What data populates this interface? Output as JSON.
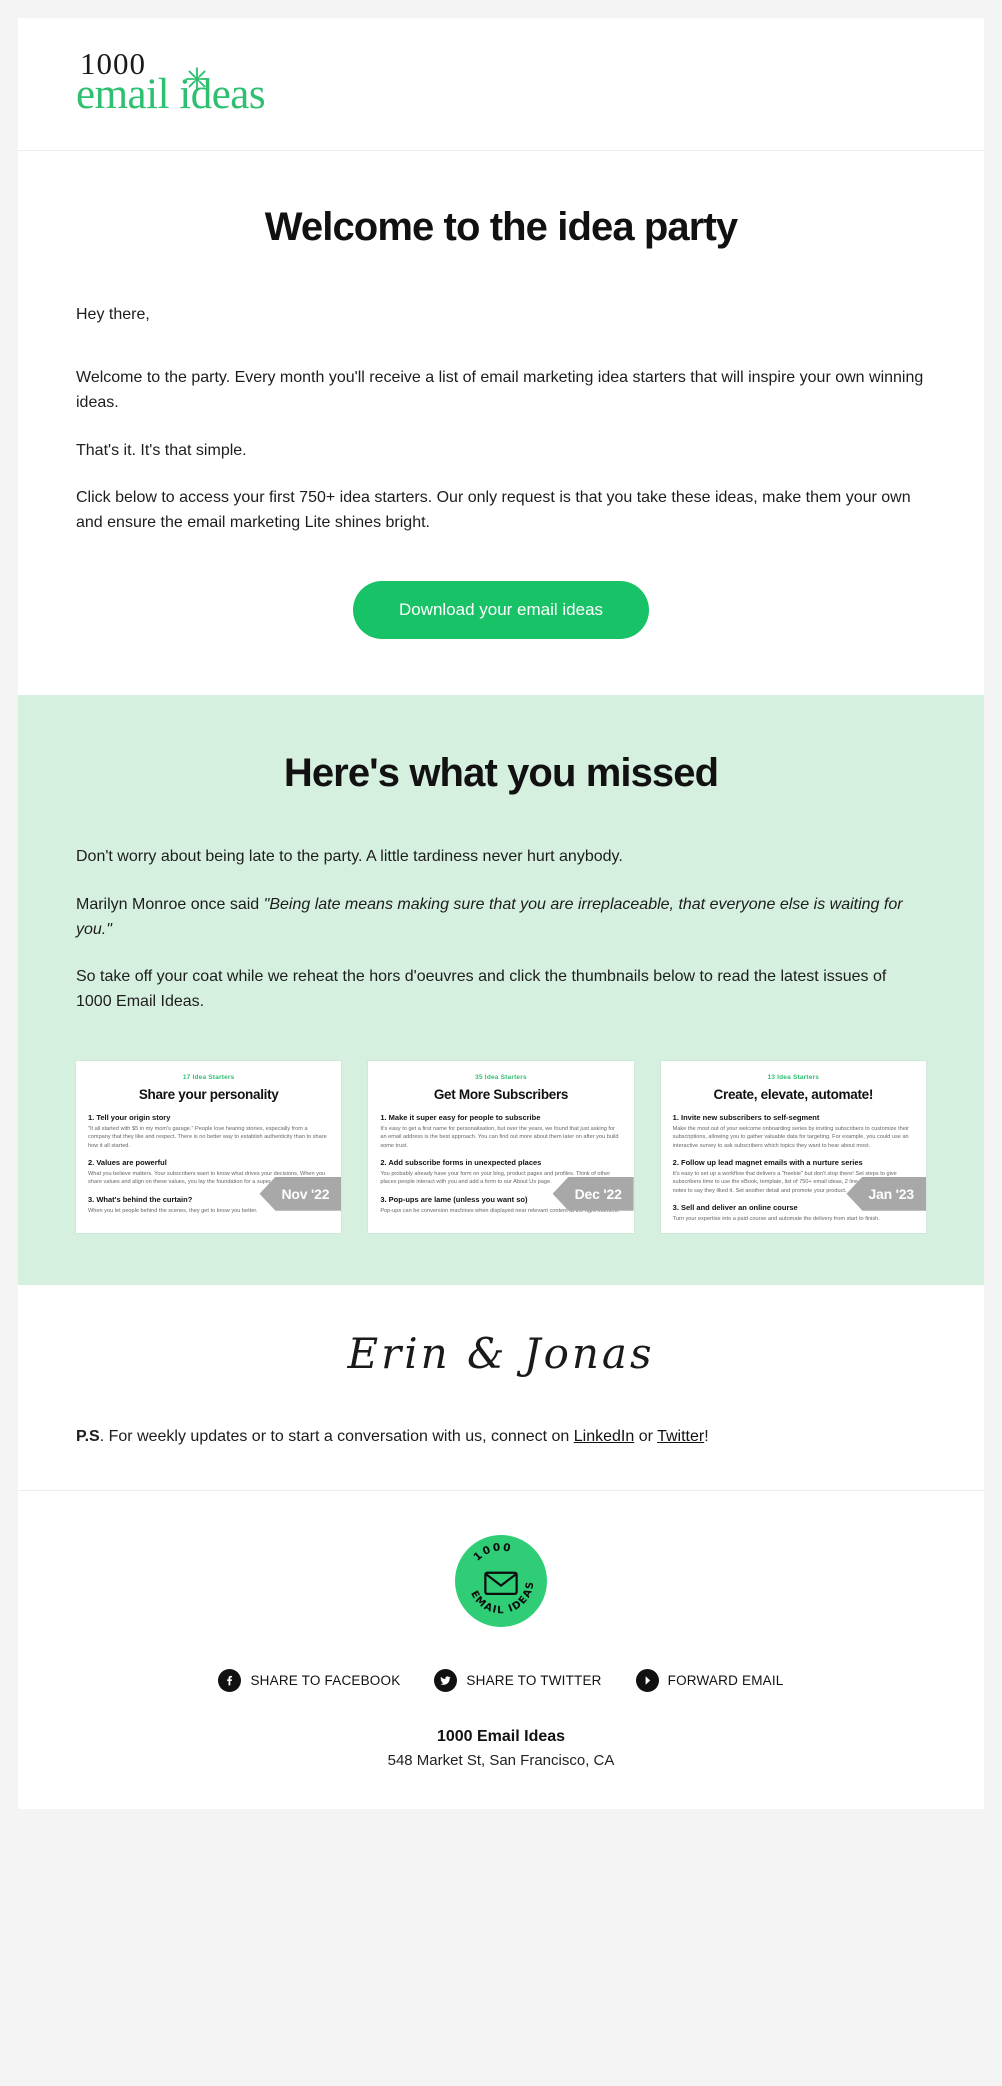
{
  "brand": {
    "logo_top": "1000",
    "logo_bottom": "email ideas",
    "spark_icon": "sparkle-icon",
    "accent_green": "#2fbf71",
    "button_green": "#18c266",
    "mint_bg": "#d6f0e0"
  },
  "intro": {
    "title": "Welcome to the idea party",
    "greeting": "Hey there,",
    "p1": "Welcome to the party. Every month you'll receive a list of email marketing idea starters that will inspire your own winning ideas.",
    "p2": "That's it. It's that simple.",
    "p3": "Click below to access your first 750+ idea starters. Our only request is that you take these ideas, make them your own and ensure the email marketing Lite shines bright.",
    "cta_label": "Download your email ideas"
  },
  "missed": {
    "title": "Here's what you missed",
    "p1": "Don't worry about being late to the party. A little tardiness never hurt anybody.",
    "quote_lead": "Marilyn Monroe once said ",
    "quote": "\"Being late means making sure that you are irreplaceable, that everyone else is waiting for you.\"",
    "p3": "So take off your coat while we reheat the hors d'oeuvres and click the thumbnails below to read the latest issues of 1000 Email Ideas.",
    "cards": [
      {
        "eyebrow": "17 Idea Starters",
        "title": "Share your personality",
        "badge": "Nov '22",
        "items": [
          {
            "heading": "1. Tell your origin story",
            "text": "\"It all started with $5 in my mom's garage.\" People love hearing stories, especially from a company that they like and respect. There is no better way to establish authenticity than to share how it all started."
          },
          {
            "heading": "2. Values are powerful",
            "text": "What you believe matters. Your subscribers want to know what drives your decisions. When you share values and align on these values, you lay the foundation for a super strong connection."
          },
          {
            "heading": "3. What's behind the curtain?",
            "text": "When you let people behind the scenes, they get to know you better."
          }
        ]
      },
      {
        "eyebrow": "35 Idea Starters",
        "title": "Get More Subscribers",
        "badge": "Dec '22",
        "items": [
          {
            "heading": "1. Make it super easy for people to subscribe",
            "text": "It's easy to get a first name for personalisation, but over the years, we found that just asking for an email address is the best approach. You can find out more about them later on after you build some trust."
          },
          {
            "heading": "2. Add subscribe forms in unexpected places",
            "text": "You probably already have your form on your blog, product pages and profiles. Think of other places people interact with you and add a form to our About Us page."
          },
          {
            "heading": "3. Pop-ups are lame (unless you want so)",
            "text": "Pop-ups can be conversion machines when displayed near relevant content at the right moment."
          }
        ]
      },
      {
        "eyebrow": "13 Idea Starters",
        "title": "Create, elevate, automate!",
        "badge": "Jan '23",
        "items": [
          {
            "heading": "1. Invite new subscribers to self-segment",
            "text": "Make the most out of your welcome onboarding series by inviting subscribers to customize their subscriptions, allowing you to gather valuable data for targeting. For example, you could use an interactive survey to ask subscribers which topics they want to hear about most."
          },
          {
            "heading": "2. Follow up lead magnet emails with a nurture series",
            "text": "It's easy to set up a workflow that delivers a \"freebie\" but don't stop there! Set steps to give subscribers time to use the eBook, template, list of 750+ email ideas, 2 line \"check up on you\" notes to say they liked it. Set another detail and promote your product."
          },
          {
            "heading": "3. Sell and deliver an online course",
            "text": "Turn your expertise into a paid course and automate the delivery from start to finish."
          }
        ]
      }
    ]
  },
  "signature": {
    "names": "Erin & Jonas",
    "ps_label": "P.S",
    "ps_text_1": ". For weekly updates or to start a conversation with us, connect on ",
    "link_linkedin": "LinkedIn",
    "ps_text_2": " or ",
    "link_twitter": "Twitter",
    "ps_text_3": "!"
  },
  "footer": {
    "badge_icon": "envelope-seal-icon",
    "badge_text": "1000 EMAIL IDEAS",
    "social": [
      {
        "icon": "facebook-icon",
        "label": "SHARE TO FACEBOOK"
      },
      {
        "icon": "twitter-icon",
        "label": "SHARE TO TWITTER"
      },
      {
        "icon": "forward-arrow-icon",
        "label": "FORWARD EMAIL"
      }
    ],
    "org_name": "1000 Email Ideas",
    "address": "548 Market St, San Francisco, CA"
  }
}
